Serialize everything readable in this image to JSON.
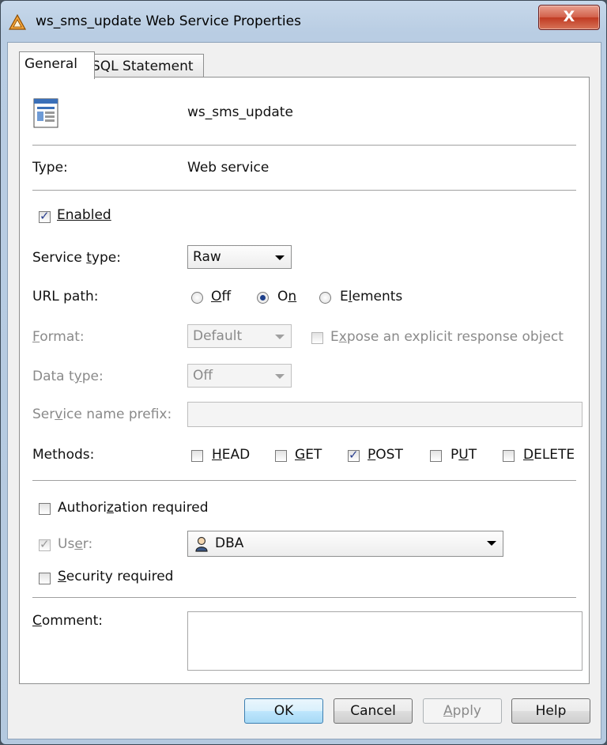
{
  "window": {
    "title": "ws_sms_update Web Service Properties",
    "close_label": "X"
  },
  "tabs": [
    {
      "label": "General",
      "active": true
    },
    {
      "label": "SQL Statement",
      "active": false
    }
  ],
  "general": {
    "service_name": "ws_sms_update",
    "type_label": "Type:",
    "type_value": "Web service",
    "enabled": {
      "label": "Enabled",
      "checked": true
    },
    "service_type": {
      "label_pre": "Service ",
      "label_key": "t",
      "label_post": "ype:",
      "value": "Raw"
    },
    "url_path": {
      "label": "URL path:",
      "options": [
        {
          "label": "Off",
          "key": "O",
          "rest": "ff",
          "selected": false
        },
        {
          "label": "On",
          "key_pre": "O",
          "key": "n",
          "selected": true
        },
        {
          "label": "Elements",
          "key_pre": "E",
          "key": "l",
          "rest": "ements",
          "selected": false
        }
      ]
    },
    "format": {
      "label_key": "F",
      "label_post": "ormat:",
      "value": "Default",
      "enabled": false
    },
    "expose": {
      "label_pre": "E",
      "label_key": "x",
      "label_post": "pose an explicit response object",
      "checked": false,
      "enabled": false
    },
    "data_type": {
      "label_pre": "Data t",
      "label_key": "y",
      "label_post": "pe:",
      "value": "Off",
      "enabled": false
    },
    "service_name_prefix": {
      "label_pre": "Ser",
      "label_key": "v",
      "label_post": "ice name prefix:",
      "value": "",
      "enabled": false
    },
    "methods": {
      "label": "Methods:",
      "items": [
        {
          "key": "H",
          "rest": "EAD",
          "checked": false
        },
        {
          "key": "G",
          "rest": "ET",
          "checked": false
        },
        {
          "key": "P",
          "rest": "OST",
          "checked": true
        },
        {
          "pre": "P",
          "key": "U",
          "rest": "T",
          "checked": false
        },
        {
          "key": "D",
          "rest": "ELETE",
          "checked": false
        }
      ]
    },
    "authorization": {
      "label_pre": "Authori",
      "label_key": "z",
      "label_post": "ation required",
      "checked": false
    },
    "user": {
      "label_pre": "Us",
      "label_key": "e",
      "label_post": "r:",
      "checked": true,
      "enabled": false,
      "value": "DBA"
    },
    "security": {
      "label_key": "S",
      "label_post": "ecurity required",
      "checked": false
    },
    "comment": {
      "label_key": "C",
      "label_post": "omment:",
      "value": ""
    }
  },
  "buttons": {
    "ok": "OK",
    "cancel": "Cancel",
    "apply_key": "A",
    "apply_rest": "pply",
    "help": "Help"
  },
  "colors": {
    "titlebar": "#b9cde3",
    "close": "#c9432a",
    "default_button": "#bee6fd"
  }
}
